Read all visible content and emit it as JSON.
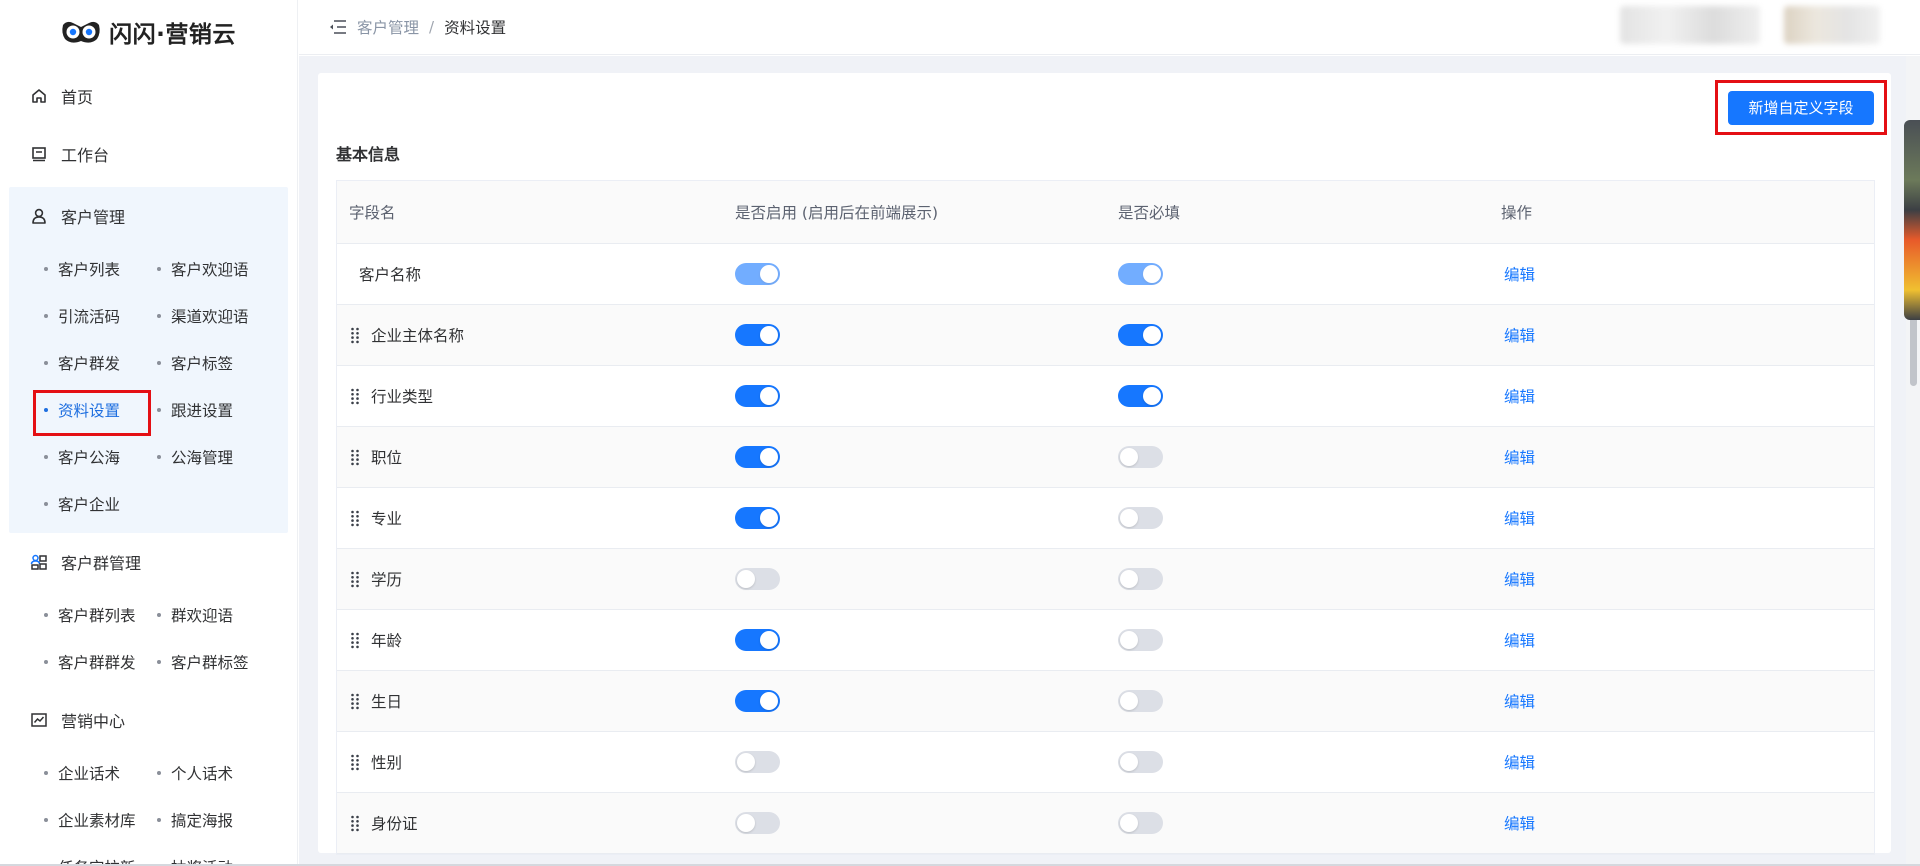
{
  "app": {
    "logo_text": "闪闪·营销云"
  },
  "sidebar": {
    "home": "首页",
    "workbench": "工作台",
    "customer_mgmt": {
      "label": "客户管理",
      "items": [
        "客户列表",
        "客户欢迎语",
        "引流活码",
        "渠道欢迎语",
        "客户群发",
        "客户标签",
        "资料设置",
        "跟进设置",
        "客户公海",
        "公海管理",
        "客户企业"
      ],
      "active": "资料设置"
    },
    "group_mgmt": {
      "label": "客户群管理",
      "items": [
        "客户群列表",
        "群欢迎语",
        "客户群群发",
        "客户群标签"
      ]
    },
    "marketing": {
      "label": "营销中心",
      "items": [
        "企业话术",
        "个人话术",
        "企业素材库",
        "搞定海报",
        "任务宝拉新",
        "抽奖活动"
      ]
    }
  },
  "header": {
    "breadcrumb_parent": "客户管理",
    "breadcrumb_sep": "/",
    "breadcrumb_current": "资料设置"
  },
  "main": {
    "add_button": "新增自定义字段",
    "section_title": "基本信息",
    "columns": {
      "name": "字段名",
      "enabled": "是否启用 (启用后在前端展示)",
      "required": "是否必填",
      "op": "操作"
    },
    "edit_label": "编辑",
    "rows": [
      {
        "name": "客户名称",
        "enabled": true,
        "required": true,
        "locked": true
      },
      {
        "name": "企业主体名称",
        "enabled": true,
        "required": true,
        "locked": false
      },
      {
        "name": "行业类型",
        "enabled": true,
        "required": true,
        "locked": false
      },
      {
        "name": "职位",
        "enabled": true,
        "required": false,
        "locked": false
      },
      {
        "name": "专业",
        "enabled": true,
        "required": false,
        "locked": false
      },
      {
        "name": "学历",
        "enabled": false,
        "required": false,
        "locked": false
      },
      {
        "name": "年龄",
        "enabled": true,
        "required": false,
        "locked": false
      },
      {
        "name": "生日",
        "enabled": true,
        "required": false,
        "locked": false
      },
      {
        "name": "性别",
        "enabled": false,
        "required": false,
        "locked": false
      },
      {
        "name": "身份证",
        "enabled": false,
        "required": false,
        "locked": false
      }
    ]
  },
  "colors": {
    "primary": "#1677ff",
    "highlight_box": "#e40f14",
    "sidebar_group_bg": "#f0f6fd"
  },
  "icons": {
    "home": "home-icon",
    "workbench": "monitor-icon",
    "customer": "user-icon",
    "group": "group-icon",
    "marketing": "chart-icon"
  }
}
